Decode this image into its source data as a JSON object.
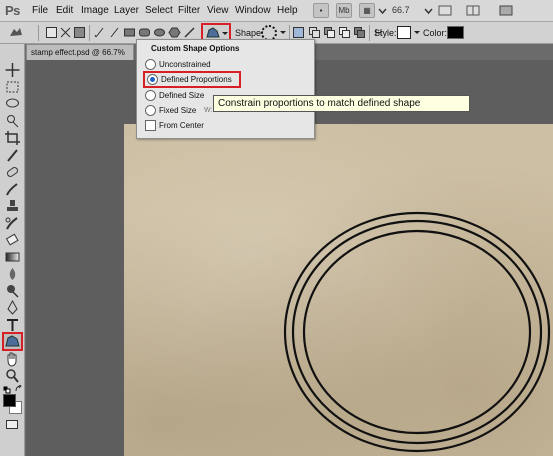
{
  "app": {
    "logo": "Ps"
  },
  "menu": {
    "items": [
      "File",
      "Edit",
      "Image",
      "Layer",
      "Select",
      "Filter",
      "View",
      "Window",
      "Help"
    ],
    "zoom": "66.7"
  },
  "options_bar": {
    "shape_label": "Shape:",
    "style_label": "Style:",
    "color_label": "Color:"
  },
  "document": {
    "tab_title": "stamp effect.psd @ 66.7%"
  },
  "custom_shape_options": {
    "title": "Custom Shape Options",
    "options": [
      {
        "label": "Unconstrained",
        "selected": false
      },
      {
        "label": "Defined Proportions",
        "selected": true
      },
      {
        "label": "Defined Size",
        "selected": false
      },
      {
        "label": "Fixed Size",
        "selected": false
      }
    ],
    "fixed_size_w": "W:",
    "from_center_label": "From Center"
  },
  "tooltip": {
    "text": "Constrain proportions to match defined shape"
  },
  "colors": {
    "foreground": "#000000",
    "background": "#ffffff",
    "highlight": "#d81f26"
  }
}
